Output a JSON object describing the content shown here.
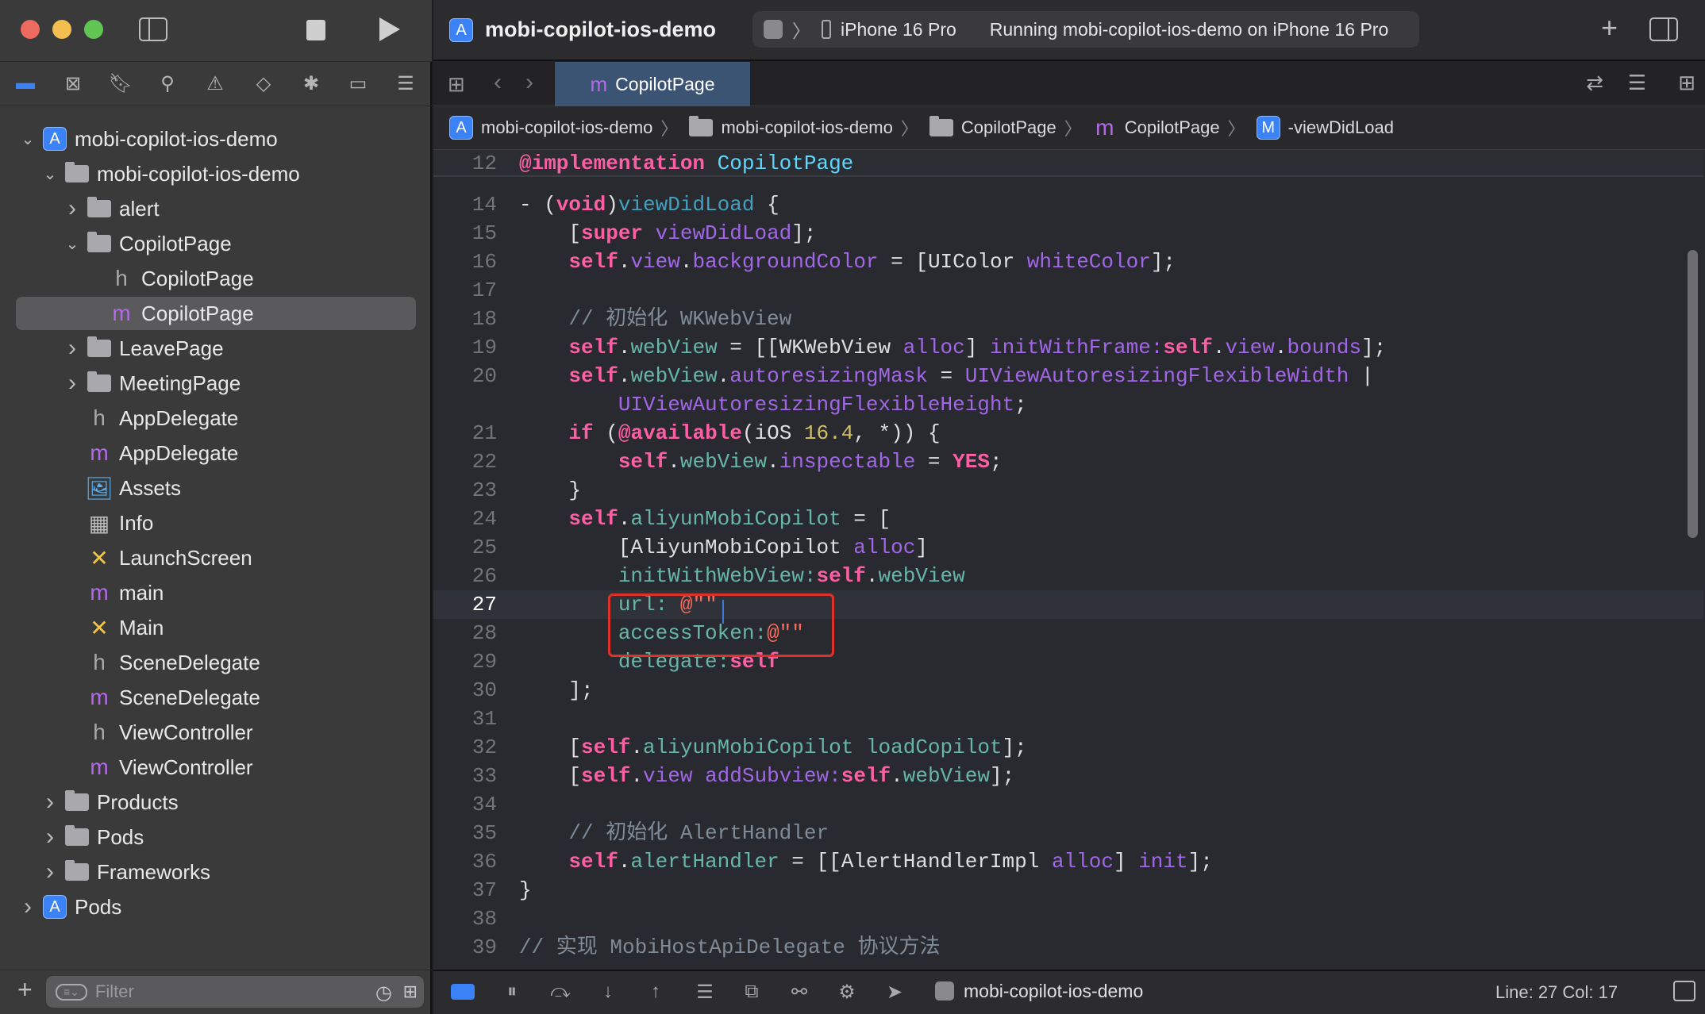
{
  "window": {
    "project_title": "mobi-copilot-ios-demo",
    "device": "iPhone 16 Pro",
    "status": "Running mobi-copilot-ios-demo on iPhone 16 Pro"
  },
  "sidebar": {
    "filter_placeholder": "Filter",
    "items": [
      {
        "label": "mobi-copilot-ios-demo",
        "level": 0,
        "chevron": "down",
        "icon": "app"
      },
      {
        "label": "mobi-copilot-ios-demo",
        "level": 1,
        "chevron": "down",
        "icon": "folder"
      },
      {
        "label": "alert",
        "level": 2,
        "chevron": "right",
        "icon": "folder"
      },
      {
        "label": "CopilotPage",
        "level": 2,
        "chevron": "down",
        "icon": "folder"
      },
      {
        "label": "CopilotPage",
        "level": 3,
        "chevron": "",
        "icon": "h"
      },
      {
        "label": "CopilotPage",
        "level": 3,
        "chevron": "",
        "icon": "m",
        "selected": true
      },
      {
        "label": "LeavePage",
        "level": 2,
        "chevron": "right",
        "icon": "folder"
      },
      {
        "label": "MeetingPage",
        "level": 2,
        "chevron": "right",
        "icon": "folder"
      },
      {
        "label": "AppDelegate",
        "level": 2,
        "chevron": "",
        "icon": "h"
      },
      {
        "label": "AppDelegate",
        "level": 2,
        "chevron": "",
        "icon": "m"
      },
      {
        "label": "Assets",
        "level": 2,
        "chevron": "",
        "icon": "assets"
      },
      {
        "label": "Info",
        "level": 2,
        "chevron": "",
        "icon": "plist"
      },
      {
        "label": "LaunchScreen",
        "level": 2,
        "chevron": "",
        "icon": "storyboard"
      },
      {
        "label": "main",
        "level": 2,
        "chevron": "",
        "icon": "m"
      },
      {
        "label": "Main",
        "level": 2,
        "chevron": "",
        "icon": "storyboard"
      },
      {
        "label": "SceneDelegate",
        "level": 2,
        "chevron": "",
        "icon": "h"
      },
      {
        "label": "SceneDelegate",
        "level": 2,
        "chevron": "",
        "icon": "m"
      },
      {
        "label": "ViewController",
        "level": 2,
        "chevron": "",
        "icon": "h"
      },
      {
        "label": "ViewController",
        "level": 2,
        "chevron": "",
        "icon": "m"
      },
      {
        "label": "Products",
        "level": 1,
        "chevron": "right",
        "icon": "folder"
      },
      {
        "label": "Pods",
        "level": 1,
        "chevron": "right",
        "icon": "folder"
      },
      {
        "label": "Frameworks",
        "level": 1,
        "chevron": "right",
        "icon": "folder"
      },
      {
        "label": "Pods",
        "level": 0,
        "chevron": "right",
        "icon": "app"
      }
    ]
  },
  "editor": {
    "tab_label": "CopilotPage",
    "breadcrumb": [
      {
        "label": "mobi-copilot-ios-demo",
        "icon": "app"
      },
      {
        "label": "mobi-copilot-ios-demo",
        "icon": "folder"
      },
      {
        "label": "CopilotPage",
        "icon": "folder"
      },
      {
        "label": "CopilotPage",
        "icon": "m"
      },
      {
        "label": "-viewDidLoad",
        "icon": "M"
      }
    ],
    "sticky": {
      "n": "12",
      "t": [
        [
          "@implementation",
          "kw"
        ],
        [
          " ",
          "p"
        ],
        [
          "CopilotPage",
          "cls"
        ]
      ]
    },
    "current_line": "27",
    "lines": [
      {
        "n": "14",
        "t": [
          [
            "- (",
            "p"
          ],
          [
            "void",
            "kw"
          ],
          [
            ")",
            "p"
          ],
          [
            "viewDidLoad",
            "decl"
          ],
          [
            " {",
            "p"
          ]
        ]
      },
      {
        "n": "15",
        "t": [
          [
            "    [",
            "p"
          ],
          [
            "super",
            "kw"
          ],
          [
            " ",
            "p"
          ],
          [
            "viewDidLoad",
            "sys"
          ],
          [
            "];",
            "p"
          ]
        ]
      },
      {
        "n": "16",
        "t": [
          [
            "    ",
            "p"
          ],
          [
            "self",
            "kw"
          ],
          [
            ".",
            "p"
          ],
          [
            "view",
            "sys"
          ],
          [
            ".",
            "p"
          ],
          [
            "backgroundColor",
            "sys"
          ],
          [
            " = [",
            "p"
          ],
          [
            "UIColor",
            "p"
          ],
          [
            " ",
            "p"
          ],
          [
            "whiteColor",
            "sys"
          ],
          [
            "];",
            "p"
          ]
        ]
      },
      {
        "n": "17",
        "t": []
      },
      {
        "n": "18",
        "t": [
          [
            "    // 初始化 WKWebView",
            "cmt"
          ]
        ]
      },
      {
        "n": "19",
        "t": [
          [
            "    ",
            "p"
          ],
          [
            "self",
            "kw"
          ],
          [
            ".",
            "p"
          ],
          [
            "webView",
            "proj"
          ],
          [
            " = [[",
            "p"
          ],
          [
            "WKWebView",
            "p"
          ],
          [
            " ",
            "p"
          ],
          [
            "alloc",
            "sys"
          ],
          [
            "] ",
            "p"
          ],
          [
            "initWithFrame:",
            "sys"
          ],
          [
            "self",
            "kw"
          ],
          [
            ".",
            "p"
          ],
          [
            "view",
            "sys"
          ],
          [
            ".",
            "p"
          ],
          [
            "bounds",
            "sys"
          ],
          [
            "];",
            "p"
          ]
        ]
      },
      {
        "n": "20",
        "t": [
          [
            "    ",
            "p"
          ],
          [
            "self",
            "kw"
          ],
          [
            ".",
            "p"
          ],
          [
            "webView",
            "proj"
          ],
          [
            ".",
            "p"
          ],
          [
            "autoresizingMask",
            "sys"
          ],
          [
            " = ",
            "p"
          ],
          [
            "UIViewAutoresizingFlexibleWidth",
            "sys"
          ],
          [
            " |",
            "p"
          ]
        ]
      },
      {
        "n": "",
        "t": [
          [
            "        ",
            "p"
          ],
          [
            "UIViewAutoresizingFlexibleHeight",
            "sys"
          ],
          [
            ";",
            "p"
          ]
        ]
      },
      {
        "n": "21",
        "t": [
          [
            "    ",
            "p"
          ],
          [
            "if",
            "kw"
          ],
          [
            " (",
            "p"
          ],
          [
            "@available",
            "kw"
          ],
          [
            "(iOS ",
            "p"
          ],
          [
            "16.4",
            "num"
          ],
          [
            ", *)) {",
            "p"
          ]
        ]
      },
      {
        "n": "22",
        "t": [
          [
            "        ",
            "p"
          ],
          [
            "self",
            "kw"
          ],
          [
            ".",
            "p"
          ],
          [
            "webView",
            "proj"
          ],
          [
            ".",
            "p"
          ],
          [
            "inspectable",
            "sys"
          ],
          [
            " = ",
            "p"
          ],
          [
            "YES",
            "kw"
          ],
          [
            ";",
            "p"
          ]
        ]
      },
      {
        "n": "23",
        "t": [
          [
            "    }",
            "p"
          ]
        ]
      },
      {
        "n": "24",
        "t": [
          [
            "    ",
            "p"
          ],
          [
            "self",
            "kw"
          ],
          [
            ".",
            "p"
          ],
          [
            "aliyunMobiCopilot",
            "proj"
          ],
          [
            " = [",
            "p"
          ]
        ]
      },
      {
        "n": "25",
        "t": [
          [
            "        [AliyunMobiCopilot",
            "p"
          ],
          [
            " ",
            "p"
          ],
          [
            "alloc",
            "sys"
          ],
          [
            "]",
            "p"
          ]
        ]
      },
      {
        "n": "26",
        "t": [
          [
            "        ",
            "p"
          ],
          [
            "initWithWebView:",
            "proj"
          ],
          [
            "self",
            "kw"
          ],
          [
            ".",
            "p"
          ],
          [
            "webView",
            "proj"
          ]
        ]
      },
      {
        "n": "27",
        "t": [
          [
            "        ",
            "p"
          ],
          [
            "url:",
            "proj"
          ],
          [
            " ",
            "p"
          ],
          [
            "@\"\"",
            "str"
          ]
        ]
      },
      {
        "n": "28",
        "t": [
          [
            "        ",
            "p"
          ],
          [
            "accessToken:",
            "proj"
          ],
          [
            "@\"\"",
            "str"
          ]
        ]
      },
      {
        "n": "29",
        "t": [
          [
            "        ",
            "p"
          ],
          [
            "delegate:",
            "proj"
          ],
          [
            "self",
            "kw"
          ]
        ]
      },
      {
        "n": "30",
        "t": [
          [
            "    ];",
            "p"
          ]
        ]
      },
      {
        "n": "31",
        "t": []
      },
      {
        "n": "32",
        "t": [
          [
            "    [",
            "p"
          ],
          [
            "self",
            "kw"
          ],
          [
            ".",
            "p"
          ],
          [
            "aliyunMobiCopilot",
            "proj"
          ],
          [
            " ",
            "p"
          ],
          [
            "loadCopilot",
            "proj"
          ],
          [
            "];",
            "p"
          ]
        ]
      },
      {
        "n": "33",
        "t": [
          [
            "    [",
            "p"
          ],
          [
            "self",
            "kw"
          ],
          [
            ".",
            "p"
          ],
          [
            "view",
            "sys"
          ],
          [
            " ",
            "p"
          ],
          [
            "addSubview:",
            "sys"
          ],
          [
            "self",
            "kw"
          ],
          [
            ".",
            "p"
          ],
          [
            "webView",
            "proj"
          ],
          [
            "];",
            "p"
          ]
        ]
      },
      {
        "n": "34",
        "t": []
      },
      {
        "n": "35",
        "t": [
          [
            "    // 初始化 AlertHandler",
            "cmt"
          ]
        ]
      },
      {
        "n": "36",
        "t": [
          [
            "    ",
            "p"
          ],
          [
            "self",
            "kw"
          ],
          [
            ".",
            "p"
          ],
          [
            "alertHandler",
            "proj"
          ],
          [
            " = [[",
            "p"
          ],
          [
            "AlertHandlerImpl",
            "p"
          ],
          [
            " ",
            "p"
          ],
          [
            "alloc",
            "sys"
          ],
          [
            "] ",
            "p"
          ],
          [
            "init",
            "sys"
          ],
          [
            "];",
            "p"
          ]
        ]
      },
      {
        "n": "37",
        "t": [
          [
            "}",
            "p"
          ]
        ]
      },
      {
        "n": "38",
        "t": []
      },
      {
        "n": "39",
        "t": [
          [
            "// 实现 MobiHostApiDelegate 协议方法",
            "cmt"
          ]
        ]
      }
    ]
  },
  "debugbar": {
    "target": "mobi-copilot-ios-demo",
    "position": "Line: 27  Col: 17"
  },
  "colors": {
    "accent": "#3b82f6",
    "highlight_box": "#e0302a",
    "keyword": "#fc5fa3",
    "string": "#fc6a5d",
    "comment": "#7f8c98"
  }
}
